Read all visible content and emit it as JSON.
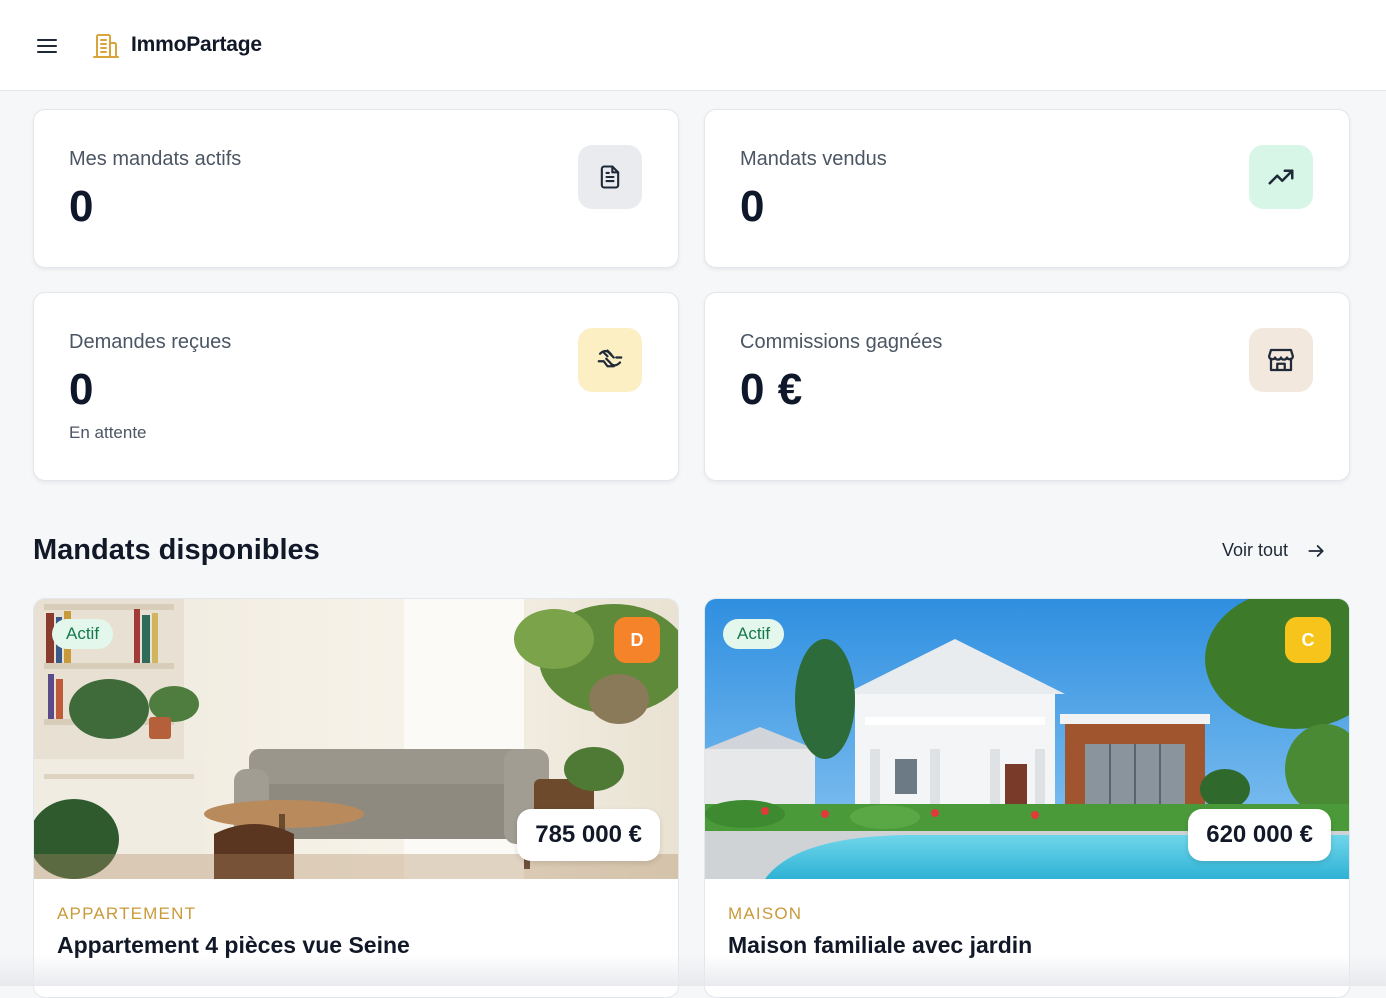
{
  "header": {
    "menu_icon": "hamburger-icon",
    "brand_icon": "building-icon",
    "brand_name": "ImmoPartage"
  },
  "stats": [
    {
      "title": "Mes mandats actifs",
      "value": "0",
      "icon": "document-icon",
      "icon_bg": "#e9ebef",
      "icon_color": "#1f2937"
    },
    {
      "title": "Mandats vendus",
      "value": "0",
      "icon": "trending-up-icon",
      "icon_bg": "#d8f6e8",
      "icon_color": "#1f2937"
    },
    {
      "title": "Demandes reçues",
      "value": "0",
      "subtitle": "En attente",
      "icon": "handshake-icon",
      "icon_bg": "#fcefc4",
      "icon_color": "#1f2937"
    },
    {
      "title": "Commissions gagnées",
      "value": "0 €",
      "icon": "store-icon",
      "icon_bg": "#f3e8dd",
      "icon_color": "#1f2937"
    }
  ],
  "section": {
    "title": "Mandats disponibles",
    "see_all": "Voir tout"
  },
  "listings": [
    {
      "status": "Actif",
      "grade": "D",
      "grade_color": "#f5832a",
      "price": "785 000 €",
      "type": "APPARTEMENT",
      "title": "Appartement 4 pièces vue Seine"
    },
    {
      "status": "Actif",
      "grade": "C",
      "grade_color": "#f6c41b",
      "price": "620 000 €",
      "type": "MAISON",
      "title": "Maison familiale avec jardin"
    }
  ]
}
